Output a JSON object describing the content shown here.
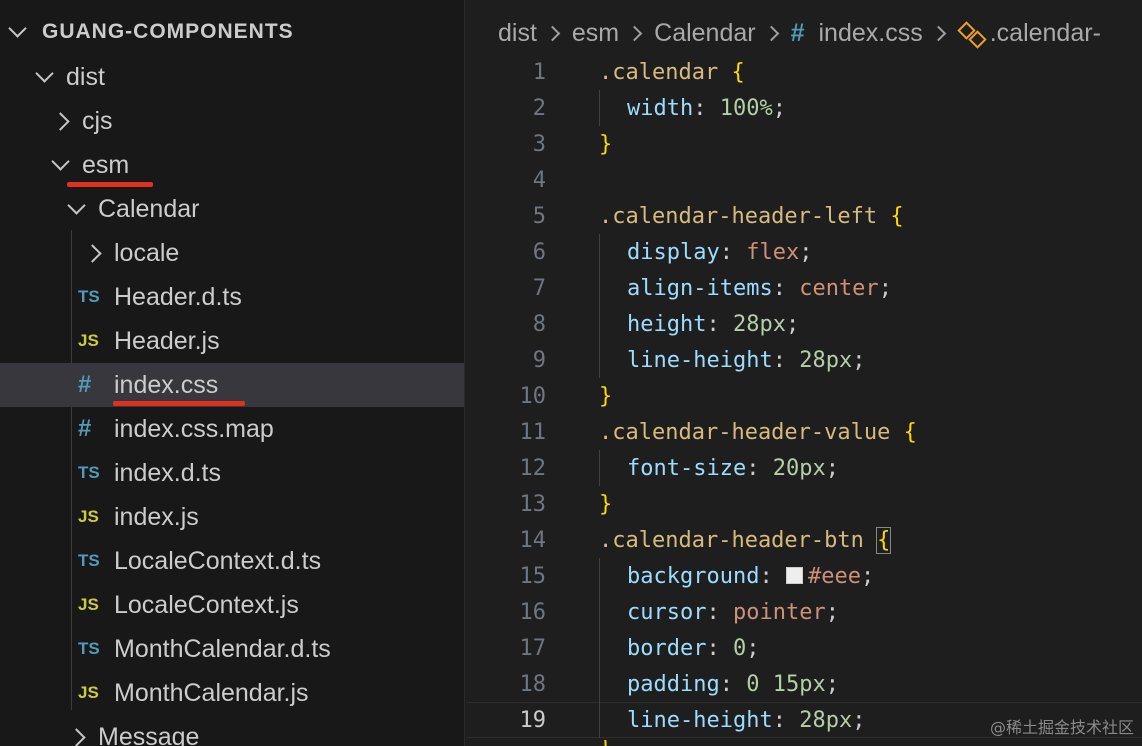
{
  "explorer": {
    "title": "GUANG-COMPONENTS",
    "items": [
      {
        "label": "dist",
        "kind": "folder",
        "expanded": true
      },
      {
        "label": "cjs",
        "kind": "folder",
        "expanded": false
      },
      {
        "label": "esm",
        "kind": "folder",
        "expanded": true
      },
      {
        "label": "Calendar",
        "kind": "folder",
        "expanded": true
      },
      {
        "label": "locale",
        "kind": "folder",
        "expanded": false
      },
      {
        "label": "Header.d.ts",
        "kind": "file",
        "icon": "TS"
      },
      {
        "label": "Header.js",
        "kind": "file",
        "icon": "JS"
      },
      {
        "label": "index.css",
        "kind": "file",
        "icon": "#",
        "selected": true
      },
      {
        "label": "index.css.map",
        "kind": "file",
        "icon": "#"
      },
      {
        "label": "index.d.ts",
        "kind": "file",
        "icon": "TS"
      },
      {
        "label": "index.js",
        "kind": "file",
        "icon": "JS"
      },
      {
        "label": "LocaleContext.d.ts",
        "kind": "file",
        "icon": "TS"
      },
      {
        "label": "LocaleContext.js",
        "kind": "file",
        "icon": "JS"
      },
      {
        "label": "MonthCalendar.d.ts",
        "kind": "file",
        "icon": "TS"
      },
      {
        "label": "MonthCalendar.js",
        "kind": "file",
        "icon": "JS"
      },
      {
        "label": "Message",
        "kind": "folder",
        "expanded": false
      }
    ]
  },
  "breadcrumb": {
    "items": [
      "dist",
      "esm",
      "Calendar"
    ],
    "file_icon": "#",
    "file": "index.css",
    "symbol": ".calendar-"
  },
  "editor": {
    "current_line": 19,
    "lines": [
      {
        "n": "1",
        "selector": ".calendar",
        "brace": "{"
      },
      {
        "n": "2",
        "prop": "width",
        "value": "100%",
        "vtype": "num"
      },
      {
        "n": "3",
        "close": "}"
      },
      {
        "n": "4"
      },
      {
        "n": "5",
        "selector": ".calendar-header-left",
        "brace": "{"
      },
      {
        "n": "6",
        "prop": "display",
        "value": "flex",
        "vtype": "kw"
      },
      {
        "n": "7",
        "prop": "align-items",
        "value": "center",
        "vtype": "kw"
      },
      {
        "n": "8",
        "prop": "height",
        "value": "28px",
        "vtype": "num"
      },
      {
        "n": "9",
        "prop": "line-height",
        "value": "28px",
        "vtype": "num"
      },
      {
        "n": "10",
        "close": "}"
      },
      {
        "n": "11",
        "selector": ".calendar-header-value",
        "brace": "{"
      },
      {
        "n": "12",
        "prop": "font-size",
        "value": "20px",
        "vtype": "num"
      },
      {
        "n": "13",
        "close": "}"
      },
      {
        "n": "14",
        "selector": ".calendar-header-btn",
        "brace": "{"
      },
      {
        "n": "15",
        "prop": "background",
        "value": "#eee",
        "vtype": "kw",
        "swatch": true
      },
      {
        "n": "16",
        "prop": "cursor",
        "value": "pointer",
        "vtype": "kw"
      },
      {
        "n": "17",
        "prop": "border",
        "value": "0",
        "vtype": "num"
      },
      {
        "n": "18",
        "prop": "padding",
        "value": "0 15px",
        "vtype": "num"
      },
      {
        "n": "19",
        "prop": "line-height",
        "value": "28px",
        "vtype": "num"
      }
    ]
  },
  "watermark": "@稀土掘金技术社区",
  "colors": {
    "selector": "#d7ba7d",
    "property": "#9cdcfe",
    "number": "#b5cea8",
    "keyword": "#ce9178",
    "brace": "#ffd700",
    "annotation_underline": "#e0311f"
  }
}
